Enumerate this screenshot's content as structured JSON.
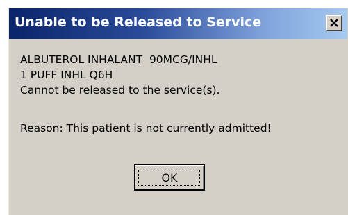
{
  "dialog": {
    "title": "Unable to be Released to Service",
    "close_icon": "close-icon",
    "message": {
      "drug_line": "ALBUTEROL INHALANT  90MCG/INHL",
      "dose_line": "1 PUFF INHL Q6H",
      "status_line": "Cannot be released to the service(s).",
      "reason_line": "Reason: This patient is not currently admitted!"
    },
    "ok_label": "OK"
  },
  "colors": {
    "titlebar_start": "#0a246a",
    "titlebar_end": "#a6caf0",
    "dialog_bg": "#d4d0c8"
  }
}
